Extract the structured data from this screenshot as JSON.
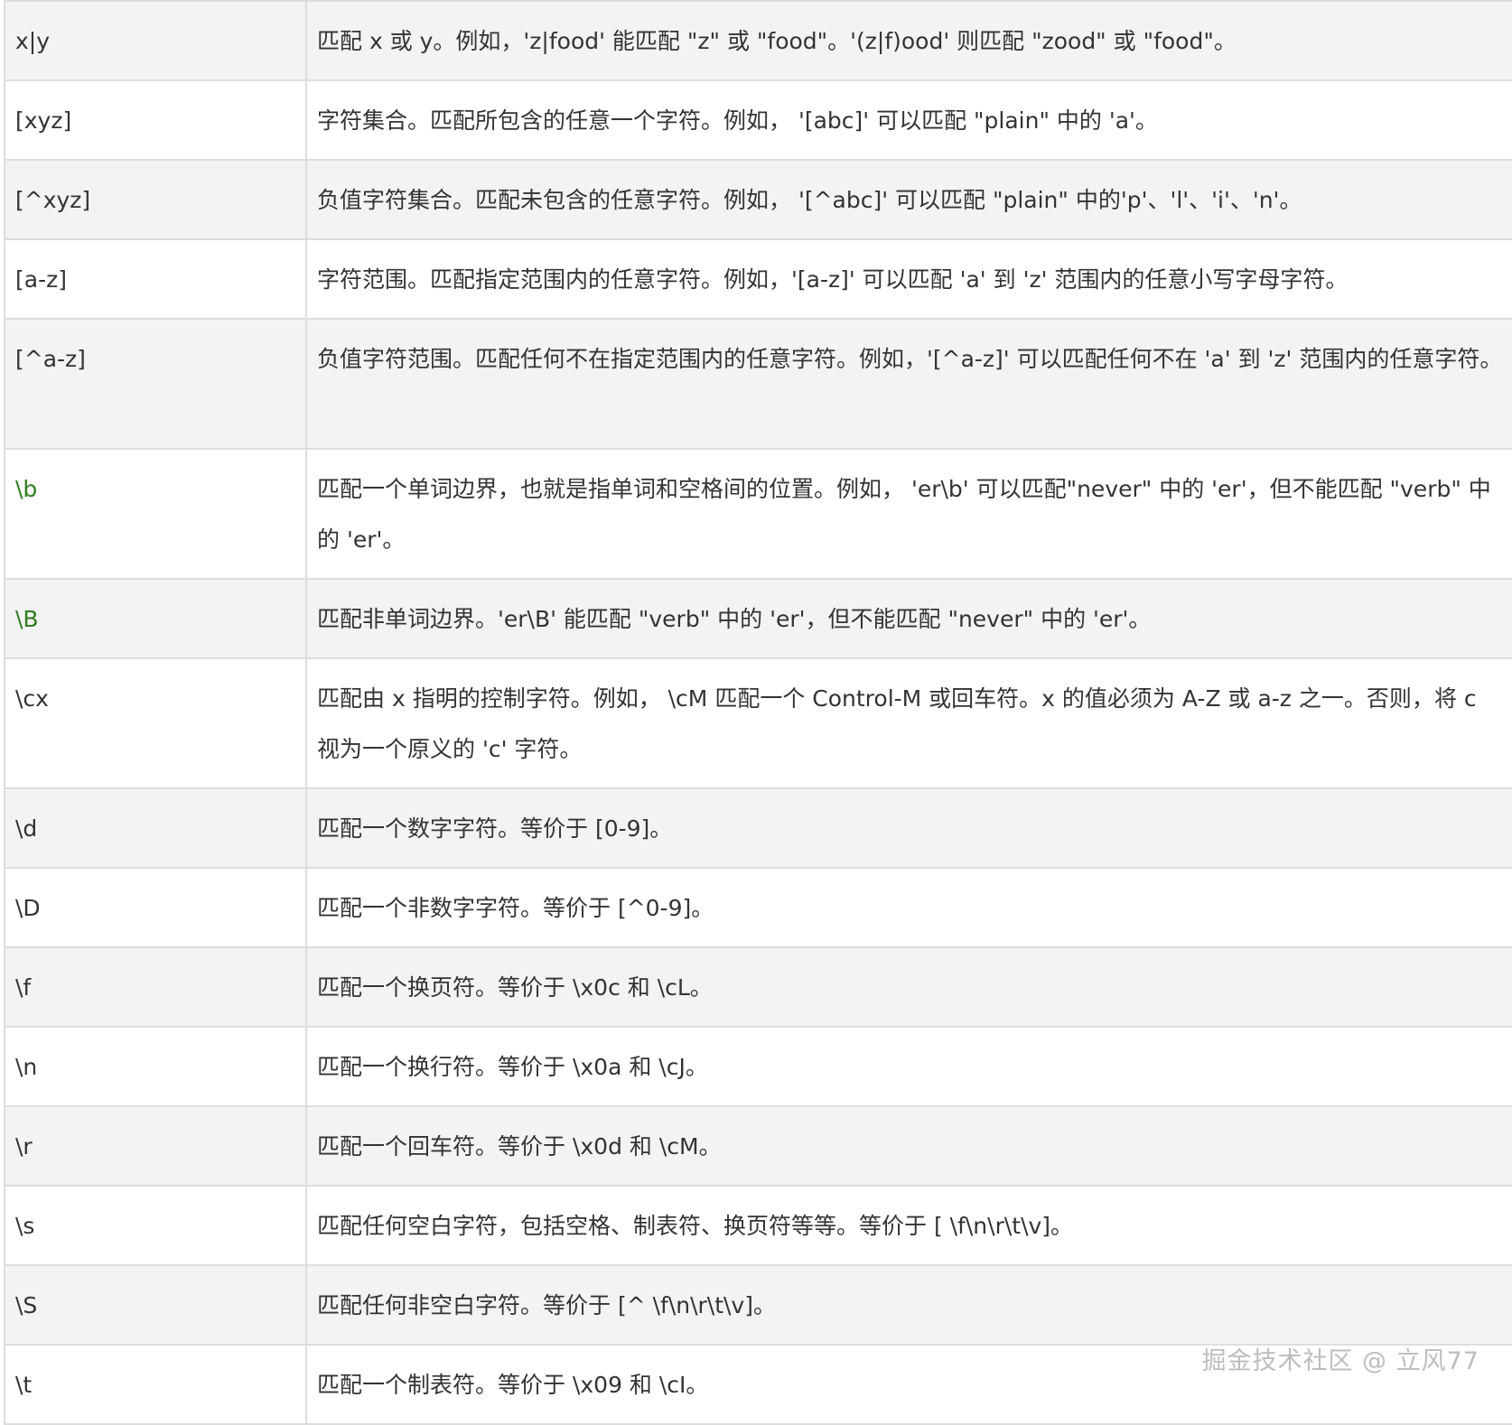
{
  "rows": [
    {
      "pattern": "x|y",
      "desc": "匹配 x 或 y。例如，'z|food' 能匹配 \"z\" 或 \"food\"。'(z|f)ood' 则匹配 \"zood\" 或 \"food\"。"
    },
    {
      "pattern": "[xyz]",
      "desc": "字符集合。匹配所包含的任意一个字符。例如， '[abc]' 可以匹配 \"plain\" 中的 'a'。"
    },
    {
      "pattern": "[^xyz]",
      "desc": "负值字符集合。匹配未包含的任意字符。例如， '[^abc]' 可以匹配 \"plain\" 中的'p'、'l'、'i'、'n'。"
    },
    {
      "pattern": "[a-z]",
      "desc": "字符范围。匹配指定范围内的任意字符。例如，'[a-z]' 可以匹配 'a' 到 'z' 范围内的任意小写字母字符。"
    },
    {
      "pattern": "[^a-z]",
      "desc": "负值字符范围。匹配任何不在指定范围内的任意字符。例如，'[^a-z]' 可以匹配任何不在 'a' 到 'z' 范围内的任意字符。"
    },
    {
      "pattern": "\\b",
      "desc": "匹配一个单词边界，也就是指单词和空格间的位置。例如， 'er\\b' 可以匹配\"never\" 中的 'er'，但不能匹配 \"verb\" 中的 'er'。"
    },
    {
      "pattern": "\\B",
      "desc": "匹配非单词边界。'er\\B' 能匹配 \"verb\" 中的 'er'，但不能匹配 \"never\" 中的 'er'。"
    },
    {
      "pattern": "\\cx",
      "desc": "匹配由 x 指明的控制字符。例如， \\cM 匹配一个 Control-M 或回车符。x 的值必须为 A-Z 或 a-z 之一。否则，将 c 视为一个原义的 'c' 字符。"
    },
    {
      "pattern": "\\d",
      "desc": "匹配一个数字字符。等价于 [0-9]。"
    },
    {
      "pattern": "\\D",
      "desc": "匹配一个非数字字符。等价于 [^0-9]。"
    },
    {
      "pattern": "\\f",
      "desc": "匹配一个换页符。等价于 \\x0c 和 \\cL。"
    },
    {
      "pattern": "\\n",
      "desc": "匹配一个换行符。等价于 \\x0a 和 \\cJ。"
    },
    {
      "pattern": "\\r",
      "desc": "匹配一个回车符。等价于 \\x0d 和 \\cM。"
    },
    {
      "pattern": "\\s",
      "desc": "匹配任何空白字符，包括空格、制表符、换页符等等。等价于 [ \\f\\n\\r\\t\\v]。"
    },
    {
      "pattern": "\\S",
      "desc": "匹配任何非空白字符。等价于 [^ \\f\\n\\r\\t\\v]。"
    },
    {
      "pattern": "\\t",
      "desc": "匹配一个制表符。等价于 \\x09 和 \\cI。"
    }
  ],
  "watermark": "掘金技术社区 @ 立风77",
  "colors": {
    "row_shade": "#f3f3f3",
    "row_plain": "#ffffff",
    "border": "#dddddd",
    "text": "#333333",
    "green_pattern": "#2e7d1e",
    "watermark": "#bdbdbd"
  }
}
